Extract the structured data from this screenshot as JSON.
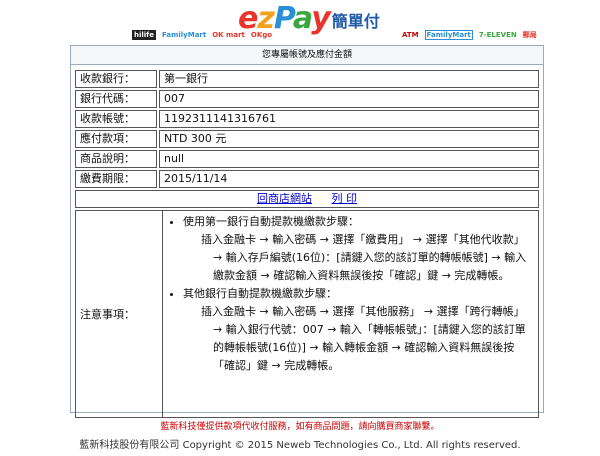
{
  "header": {
    "logo_text": "ezPay",
    "logo_cn": "簡單付",
    "stores_left": [
      "hilife",
      "FamilyMart",
      "OK mart",
      "OKgo"
    ],
    "stores_right": [
      "ATM",
      "FamilyMart",
      "7-ELEVEN",
      "郵局"
    ]
  },
  "panel_title": "您專屬帳號及應付金額",
  "rows": [
    {
      "label": "收款銀行：",
      "value": "第一銀行"
    },
    {
      "label": "銀行代碼：",
      "value": "007"
    },
    {
      "label": "收款帳號：",
      "value": "1192311141316761"
    },
    {
      "label": "應付款項：",
      "value": "NTD 300 元"
    },
    {
      "label": "商品說明：",
      "value": "null"
    },
    {
      "label": "繳費期限：",
      "value": "2015/11/14"
    }
  ],
  "links": {
    "back": "回商店網站",
    "print": "列 印"
  },
  "notes": {
    "label": "注意事項：",
    "item1": "使用第一銀行自動提款機繳款步驟：",
    "item1_step": "插入金融卡 → 輸入密碼 → 選擇「繳費用」 → 選擇「其他代收款」 → 輸入存戶編號(16位)：[請鍵入您的該訂單的轉帳帳號] → 輸入繳款金額 → 確認輸入資料無誤後按「確認」鍵 → 完成轉帳。",
    "item2": "其他銀行自動提款機繳款步驟：",
    "item2_step": "插入金融卡 → 輸入密碼 → 選擇「其他服務」 → 選擇「跨行轉帳」 → 輸入銀行代號：007 → 輸入「轉帳帳號」：[請鍵入您的該訂單的轉帳帳號(16位)] → 輸入轉帳金額 → 確認輸入資料無誤後按「確認」鍵 → 完成轉帳。"
  },
  "footer": {
    "line1": "藍新科技僅提供款項代收付服務，如有商品問題，請向購買商家聯繫。",
    "line2": "藍新科技股份有限公司 Copyright © 2015 Neweb Technologies Co., Ltd. All rights reserved."
  }
}
